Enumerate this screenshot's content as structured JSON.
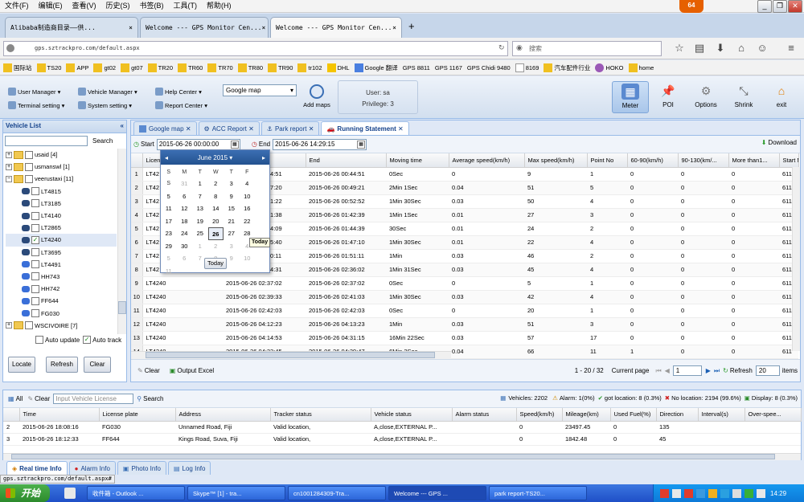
{
  "browser": {
    "menu": [
      "文件(F)",
      "编辑(E)",
      "查看(V)",
      "历史(S)",
      "书签(B)",
      "工具(T)",
      "帮助(H)"
    ],
    "ff_badge": "64",
    "window_controls": {
      "min": "_",
      "max": "❐",
      "close": "✕"
    },
    "tabs": [
      {
        "label": "Alibaba制造商目录——供...",
        "active": false
      },
      {
        "label": "Welcome --- GPS Monitor Cen...",
        "active": false
      },
      {
        "label": "Welcome --- GPS Monitor Cen...",
        "active": true
      }
    ],
    "new_tab": "+",
    "url": "gps.sztrackpro.com/default.aspx",
    "search_placeholder": "搜索",
    "bookmarks": [
      "国际站",
      "TS20",
      "APP",
      "gt02",
      "gt07",
      "TR20",
      "TR60",
      "TR70",
      "TR80",
      "TR90",
      "tr102",
      "DHL",
      "Google 翻译",
      "GPS 8811",
      "GPS 1167",
      "GPS Chidi 9480",
      "8169",
      "汽车配件行业",
      "HOKO",
      "home"
    ]
  },
  "toolbar": {
    "user_manager": "User Manager",
    "vehicle_manager": "Vehicle Manager",
    "help_center": "Help Center",
    "terminal_setting": "Terminal setting",
    "system_setting": "System setting",
    "report_center": "Report Center",
    "map_select": "Google map",
    "add_maps": "Add maps",
    "user_label": "User: sa",
    "privilege_label": "Privilege: 3",
    "meter": "Meter",
    "poi": "POI",
    "options": "Options",
    "shrink": "Shrink",
    "exit": "exit"
  },
  "vehicle_list": {
    "title": "Vehicle List",
    "collapse": "«",
    "search_label": "Search",
    "items": [
      {
        "label": "usaid [4]",
        "type": "group",
        "open": false,
        "checked": false
      },
      {
        "label": "usmanswl [1]",
        "type": "group",
        "open": false,
        "checked": false
      },
      {
        "label": "veerustaxi [11]",
        "type": "group",
        "open": true,
        "checked": false
      },
      {
        "label": "LT4815",
        "type": "vehicle",
        "checked": false
      },
      {
        "label": "LT3185",
        "type": "vehicle",
        "checked": false
      },
      {
        "label": "LT4140",
        "type": "vehicle",
        "checked": false
      },
      {
        "label": "LT2865",
        "type": "vehicle",
        "checked": false
      },
      {
        "label": "LT4240",
        "type": "vehicle",
        "checked": true
      },
      {
        "label": "LT3695",
        "type": "vehicle",
        "checked": false
      },
      {
        "label": "LT4491",
        "type": "vehicle",
        "checked": false
      },
      {
        "label": "HH743",
        "type": "vehicle",
        "checked": false
      },
      {
        "label": "HH742",
        "type": "vehicle",
        "checked": false
      },
      {
        "label": "FF644",
        "type": "vehicle",
        "checked": false
      },
      {
        "label": "FG030",
        "type": "vehicle",
        "checked": false
      },
      {
        "label": "WSCIVOIRE [7]",
        "type": "group",
        "open": false,
        "checked": false
      }
    ],
    "auto_update": "Auto update",
    "auto_track": "Auto track",
    "locate": "Locate",
    "refresh": "Refresh",
    "clear": "Clear"
  },
  "content_tabs": [
    {
      "label": "Google map",
      "active": false
    },
    {
      "label": "ACC Report",
      "active": false
    },
    {
      "label": "Park report",
      "active": false
    },
    {
      "label": "Running Statement",
      "active": true
    }
  ],
  "report": {
    "start_label": "Start",
    "start_value": "2015-06-26 00:00:00",
    "end_label": "End",
    "end_value": "2015-06-26 14:29:15",
    "download": "Download",
    "columns": [
      "Licen",
      "Start",
      "End",
      "Moving time",
      "Average speed(km/h)",
      "Max speed(km/h)",
      "Point No",
      "60-90(km/h)",
      "90-130(km/...",
      "More than1...",
      "Start M"
    ],
    "rows": [
      [
        "1",
        "LT42",
        "2015-06-26 00:44:51",
        "2015-06-26 00:44:51",
        "0Sec",
        "0",
        "9",
        "1",
        "0",
        "0",
        "0",
        "611"
      ],
      [
        "2",
        "LT42",
        "2015-06-26 00:47:20",
        "2015-06-26 00:49:21",
        "2Min 1Sec",
        "0.04",
        "51",
        "5",
        "0",
        "0",
        "0",
        "611"
      ],
      [
        "3",
        "LT42",
        "2015-06-26 00:51:22",
        "2015-06-26 00:52:52",
        "1Min 30Sec",
        "0.03",
        "50",
        "4",
        "0",
        "0",
        "0",
        "611"
      ],
      [
        "4",
        "LT42",
        "2015-06-26 01:41:38",
        "2015-06-26 01:42:39",
        "1Min 1Sec",
        "0.01",
        "27",
        "3",
        "0",
        "0",
        "0",
        "611"
      ],
      [
        "5",
        "LT42",
        "2015-06-26 01:44:09",
        "2015-06-26 01:44:39",
        "30Sec",
        "0.01",
        "24",
        "2",
        "0",
        "0",
        "0",
        "611"
      ],
      [
        "6",
        "LT42",
        "2015-06-26 01:45:40",
        "2015-06-26 01:47:10",
        "1Min 30Sec",
        "0.01",
        "22",
        "4",
        "0",
        "0",
        "0",
        "611"
      ],
      [
        "7",
        "LT42",
        "2015-06-26 01:50:11",
        "2015-06-26 01:51:11",
        "1Min",
        "0.03",
        "46",
        "2",
        "0",
        "0",
        "0",
        "611"
      ],
      [
        "8",
        "LT42",
        "2015-06-26 02:34:31",
        "2015-06-26 02:36:02",
        "1Min 31Sec",
        "0.03",
        "45",
        "4",
        "0",
        "0",
        "0",
        "611"
      ],
      [
        "9",
        "LT4240",
        "2015-06-26 02:37:02",
        "2015-06-26 02:37:02",
        "0Sec",
        "0",
        "5",
        "1",
        "0",
        "0",
        "0",
        "611"
      ],
      [
        "10",
        "LT4240",
        "2015-06-26 02:39:33",
        "2015-06-26 02:41:03",
        "1Min 30Sec",
        "0.03",
        "42",
        "4",
        "0",
        "0",
        "0",
        "611"
      ],
      [
        "11",
        "LT4240",
        "2015-06-26 02:42:03",
        "2015-06-26 02:42:03",
        "0Sec",
        "0",
        "20",
        "1",
        "0",
        "0",
        "0",
        "611"
      ],
      [
        "12",
        "LT4240",
        "2015-06-26 04:12:23",
        "2015-06-26 04:13:23",
        "1Min",
        "0.03",
        "51",
        "3",
        "0",
        "0",
        "0",
        "611"
      ],
      [
        "13",
        "LT4240",
        "2015-06-26 04:14:53",
        "2015-06-26 04:31:15",
        "16Min 22Sec",
        "0.03",
        "57",
        "17",
        "0",
        "0",
        "0",
        "611"
      ],
      [
        "14",
        "LT4240",
        "2015-06-26 04:33:45",
        "2015-06-26 04:39:47",
        "6Min 2Sec",
        "0.04",
        "66",
        "11",
        "1",
        "0",
        "0",
        "611"
      ]
    ],
    "clear": "Clear",
    "output_excel": "Output Excel",
    "page_info": "1 - 20 / 32",
    "current_page": "Current page",
    "page": "1",
    "refresh": "Refresh",
    "per_page": "20",
    "items": "items"
  },
  "calendar": {
    "month_label": "June 2015 ▾",
    "prev": "◂",
    "next": "▸",
    "weekdays": [
      "S",
      "M",
      "T",
      "W",
      "T",
      "F",
      "S"
    ],
    "days": [
      [
        "31",
        "1",
        "2",
        "3",
        "4",
        "5",
        "6"
      ],
      [
        "7",
        "8",
        "9",
        "10",
        "11",
        "12",
        "13"
      ],
      [
        "14",
        "15",
        "16",
        "17",
        "18",
        "19",
        "20"
      ],
      [
        "21",
        "22",
        "23",
        "24",
        "25",
        "26",
        "27"
      ],
      [
        "28",
        "29",
        "30",
        "1",
        "2",
        "3",
        "4"
      ],
      [
        "5",
        "6",
        "7",
        "8",
        "9",
        "10",
        "11"
      ]
    ],
    "selected": "26",
    "tooltip": "Today",
    "today_button": "Today"
  },
  "bottom": {
    "all": "All",
    "clear": "Clear",
    "input_placeholder": "Input Vehicle License",
    "search": "Search",
    "vehicles": "Vehicles: 2202",
    "alarm": "Alarm: 1(0%)",
    "got_location": "got location: 8 (0.3%)",
    "no_location": "No location: 2194 (99.6%)",
    "display": "Display: 8 (0.3%)",
    "columns": [
      "Time",
      "License plate",
      "Address",
      "Tracker status",
      "Vehicle status",
      "Alarm status",
      "Speed(km/h)",
      "Mileage(km)",
      "Used Fuel(%)",
      "Direction",
      "Interval(s)",
      "Over-spee..."
    ],
    "rows": [
      [
        "2",
        "2015-06-26 18:08:16",
        "FG030",
        "Unnamed Road, Fiji",
        "Valid location,",
        "A,close,EXTERNAL P...",
        "",
        "0",
        "23497.45",
        "0",
        "135",
        "",
        ""
      ],
      [
        "3",
        "2015-06-26 18:12:33",
        "FF644",
        "Kings Road, Suva, Fiji",
        "Valid location,",
        "A,close,EXTERNAL P...",
        "",
        "0",
        "1842.48",
        "0",
        "45",
        "",
        ""
      ]
    ],
    "tabs": [
      "Real time Info",
      "Alarm Info",
      "Photo Info",
      "Log Info"
    ]
  },
  "status_url": "gps.sztrackpro.com/default.aspx#",
  "taskbar": {
    "start": "开始",
    "items": [
      "收件箱 - Outlook ...",
      "Skype™ [1] - tra...",
      "cn1001284309-Tra...",
      "Welcome --- GPS ...",
      "park report-TS20..."
    ],
    "clock": "14:29"
  }
}
